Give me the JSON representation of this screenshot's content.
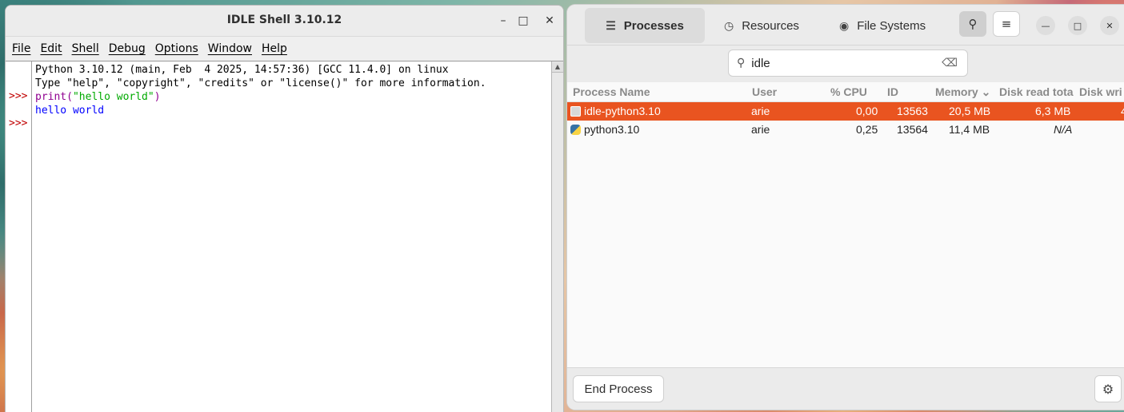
{
  "idle": {
    "title": "IDLE Shell 3.10.12",
    "controls": {
      "minimize": "–",
      "maximize": "□",
      "close": "✕"
    },
    "menu": [
      "File",
      "Edit",
      "Shell",
      "Debug",
      "Options",
      "Window",
      "Help"
    ],
    "prompt": ">>>",
    "banner_line1": "Python 3.10.12 (main, Feb  4 2025, 14:57:36) [GCC 11.4.0] on linux",
    "banner_line2": "Type \"help\", \"copyright\", \"credits\" or \"license()\" for more information.",
    "command_builtin": "print(",
    "command_string": "\"hello world\"",
    "command_close": ")",
    "output": "hello world"
  },
  "sysmon": {
    "tabs": [
      {
        "label": "Processes",
        "icon": "list-icon",
        "glyph": "☰"
      },
      {
        "label": "Resources",
        "icon": "gauge-icon",
        "glyph": "◷"
      },
      {
        "label": "File Systems",
        "icon": "disk-icon",
        "glyph": "◉"
      }
    ],
    "search_glyph": "⚲",
    "menu_glyph": "≡",
    "controls": {
      "minimize": "—",
      "maximize": "□",
      "close": "✕"
    },
    "search_value": "idle",
    "clear_glyph": "⌫",
    "columns": [
      "Process Name",
      "User",
      "% CPU",
      "ID",
      "Memory ⌄",
      "Disk read tota",
      "Disk wri"
    ],
    "rows": [
      {
        "name": "idle-python3.10",
        "user": "arie",
        "cpu": "0,00",
        "id": "13563",
        "memory": "20,5 MB",
        "disk_read": "6,3 MB",
        "disk_write": "4",
        "icon": "idle-process-icon"
      },
      {
        "name": "python3.10",
        "user": "arie",
        "cpu": "0,25",
        "id": "13564",
        "memory": "11,4 MB",
        "disk_read": "N/A",
        "disk_write": "",
        "icon": "python-icon"
      }
    ],
    "end_process_label": "End Process",
    "gear_glyph": "⚙",
    "accent": "#e95420"
  }
}
